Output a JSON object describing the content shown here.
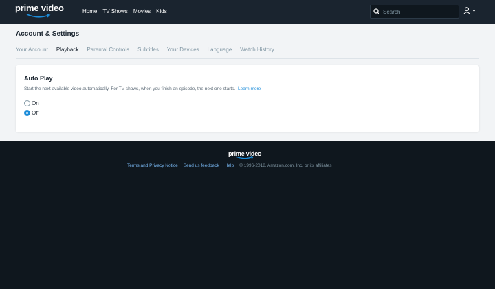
{
  "header": {
    "logo_text": "prime video",
    "nav": [
      "Home",
      "TV Shows",
      "Movies",
      "Kids"
    ],
    "search_placeholder": "Search",
    "colors": {
      "bar": "#1a242f",
      "accent": "#1c8cd9"
    }
  },
  "page": {
    "title": "Account & Settings",
    "tabs": [
      "Your Account",
      "Playback",
      "Parental Controls",
      "Subtitles",
      "Your Devices",
      "Language",
      "Watch History"
    ],
    "active_tab": "Playback"
  },
  "autoplay": {
    "title": "Auto Play",
    "description": "Start the next available video automatically. For TV shows, when you finish an episode, the next one starts.",
    "learn_more": "Learn more",
    "options": [
      {
        "label": "On",
        "checked": false
      },
      {
        "label": "Off",
        "checked": true
      }
    ]
  },
  "footer": {
    "logo_text": "prime video",
    "links": [
      "Terms and Privacy Notice",
      "Send us feedback",
      "Help"
    ],
    "copyright": "© 1996-2018, Amazon.com, Inc. or its affiliates"
  }
}
